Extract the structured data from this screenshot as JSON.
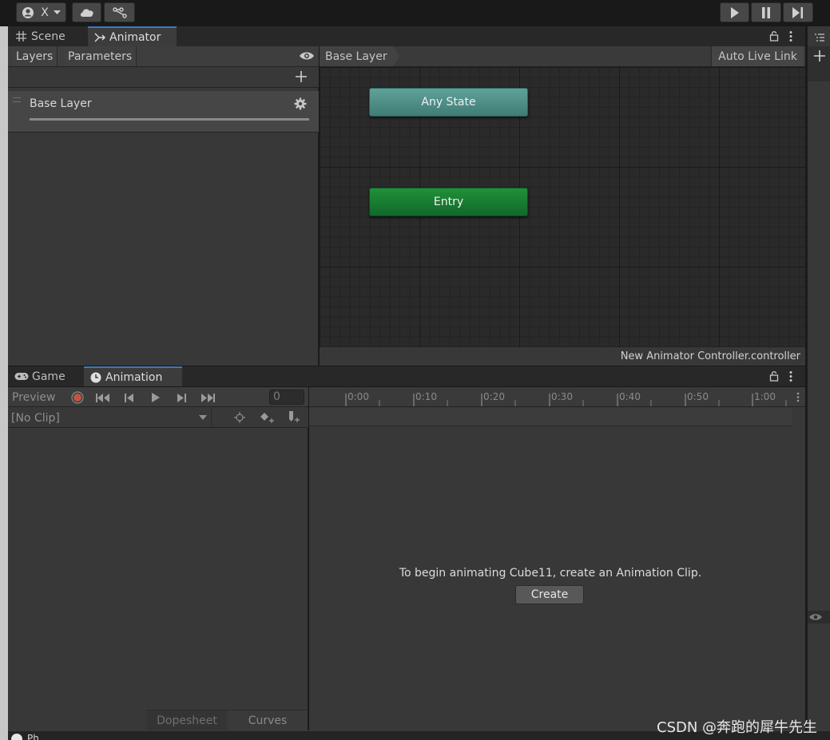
{
  "toolbar": {
    "account_label": "X",
    "account_icon": "account-icon",
    "cloud_icon": "cloud-icon",
    "collab_icon": "collab-icon",
    "play_icon": "play-icon",
    "pause_icon": "pause-icon",
    "step_icon": "step-icon"
  },
  "top_panel": {
    "tabs": [
      {
        "label": "Scene",
        "icon": "grid-icon"
      },
      {
        "label": "Animator",
        "icon": "animator-icon"
      }
    ],
    "layers_tab": "Layers",
    "parameters_tab": "Parameters",
    "layers": [
      {
        "name": "Base Layer"
      }
    ],
    "breadcrumb": "Base Layer",
    "auto_live_link": "Auto Live Link",
    "controller_name": "New Animator Controller.controller",
    "nodes": {
      "any_state": "Any State",
      "entry": "Entry"
    },
    "colors": {
      "any_state": "#4d8c86",
      "entry": "#1a7a2e"
    }
  },
  "bottom_panel": {
    "tabs": [
      {
        "label": "Game",
        "icon": "gamepad-icon"
      },
      {
        "label": "Animation",
        "icon": "clock-icon"
      }
    ],
    "preview_label": "Preview",
    "frame_value": "0",
    "clip_select": "[No Clip]",
    "timeline_ticks": [
      "0:00",
      "0:10",
      "0:20",
      "0:30",
      "0:40",
      "0:50",
      "1:00"
    ],
    "message": "To begin animating Cube11, create an Animation Clip.",
    "create_label": "Create",
    "dopesheet_label": "Dopesheet",
    "curves_label": "Curves"
  },
  "status": {
    "partial_label": "Ph...",
    "watermark": "CSDN @奔跑的犀牛先生"
  }
}
